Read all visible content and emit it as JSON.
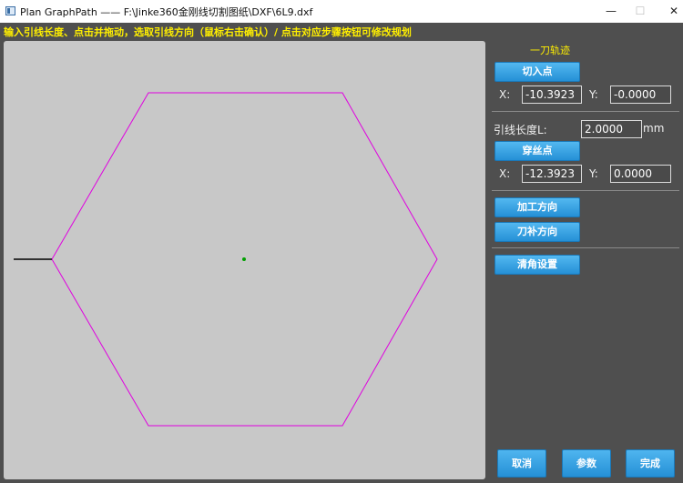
{
  "window": {
    "title": "Plan GraphPath —— F:\\Jinke360金刚线切割图纸\\DXF\\6L9.dxf",
    "minimize_glyph": "—",
    "maximize_glyph": "☐",
    "close_glyph": "✕"
  },
  "instruction": "输入引线长度、点击并拖动，选取引线方向（鼠标右击确认）/ 点击对应步骤按钮可修改规划",
  "panel": {
    "section_title": "一刀轨迹",
    "entry_point": {
      "button_label": "切入点",
      "x_label": "X:",
      "x_value": "-10.3923",
      "y_label": "Y:",
      "y_value": "-0.0000"
    },
    "lead_length": {
      "label": "引线长度L:",
      "value": "2.0000",
      "unit": "mm"
    },
    "thread_point": {
      "button_label": "穿丝点",
      "x_label": "X:",
      "x_value": "-12.3923",
      "y_label": "Y:",
      "y_value": "0.0000"
    },
    "machining_direction_label": "加工方向",
    "compensation_direction_label": "刀补方向",
    "corner_clear_label": "清角设置"
  },
  "footer": {
    "cancel_label": "取消",
    "params_label": "参数",
    "finish_label": "完成"
  },
  "colors": {
    "canvas_bg": "#c8c8c8",
    "panel_bg": "#4f4f4f",
    "contour": "#e000e0",
    "lead_line": "#000000",
    "center_point": "#00a000",
    "accent_text": "#ffef00",
    "button": "#2e9ee0"
  }
}
